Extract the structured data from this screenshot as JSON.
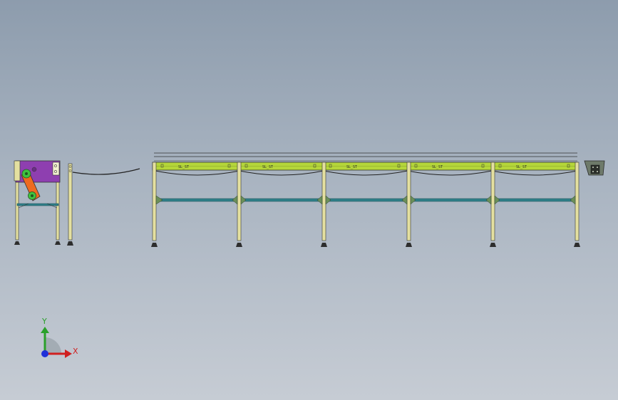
{
  "triad": {
    "x_label": "X",
    "y_label": "Y"
  },
  "conveyor": {
    "beam_labels": [
      "SL_ST",
      "SL_ST",
      "SL_ST",
      "SL_ST",
      "SL_ST"
    ],
    "colors": {
      "beam": "#b5d63a",
      "leg": "#e4e0a0",
      "crossbar": "#2f7f88",
      "gearbox": "#8e3fb0",
      "arm": "#ee6a1f",
      "pulley": "#3fc23f"
    }
  }
}
